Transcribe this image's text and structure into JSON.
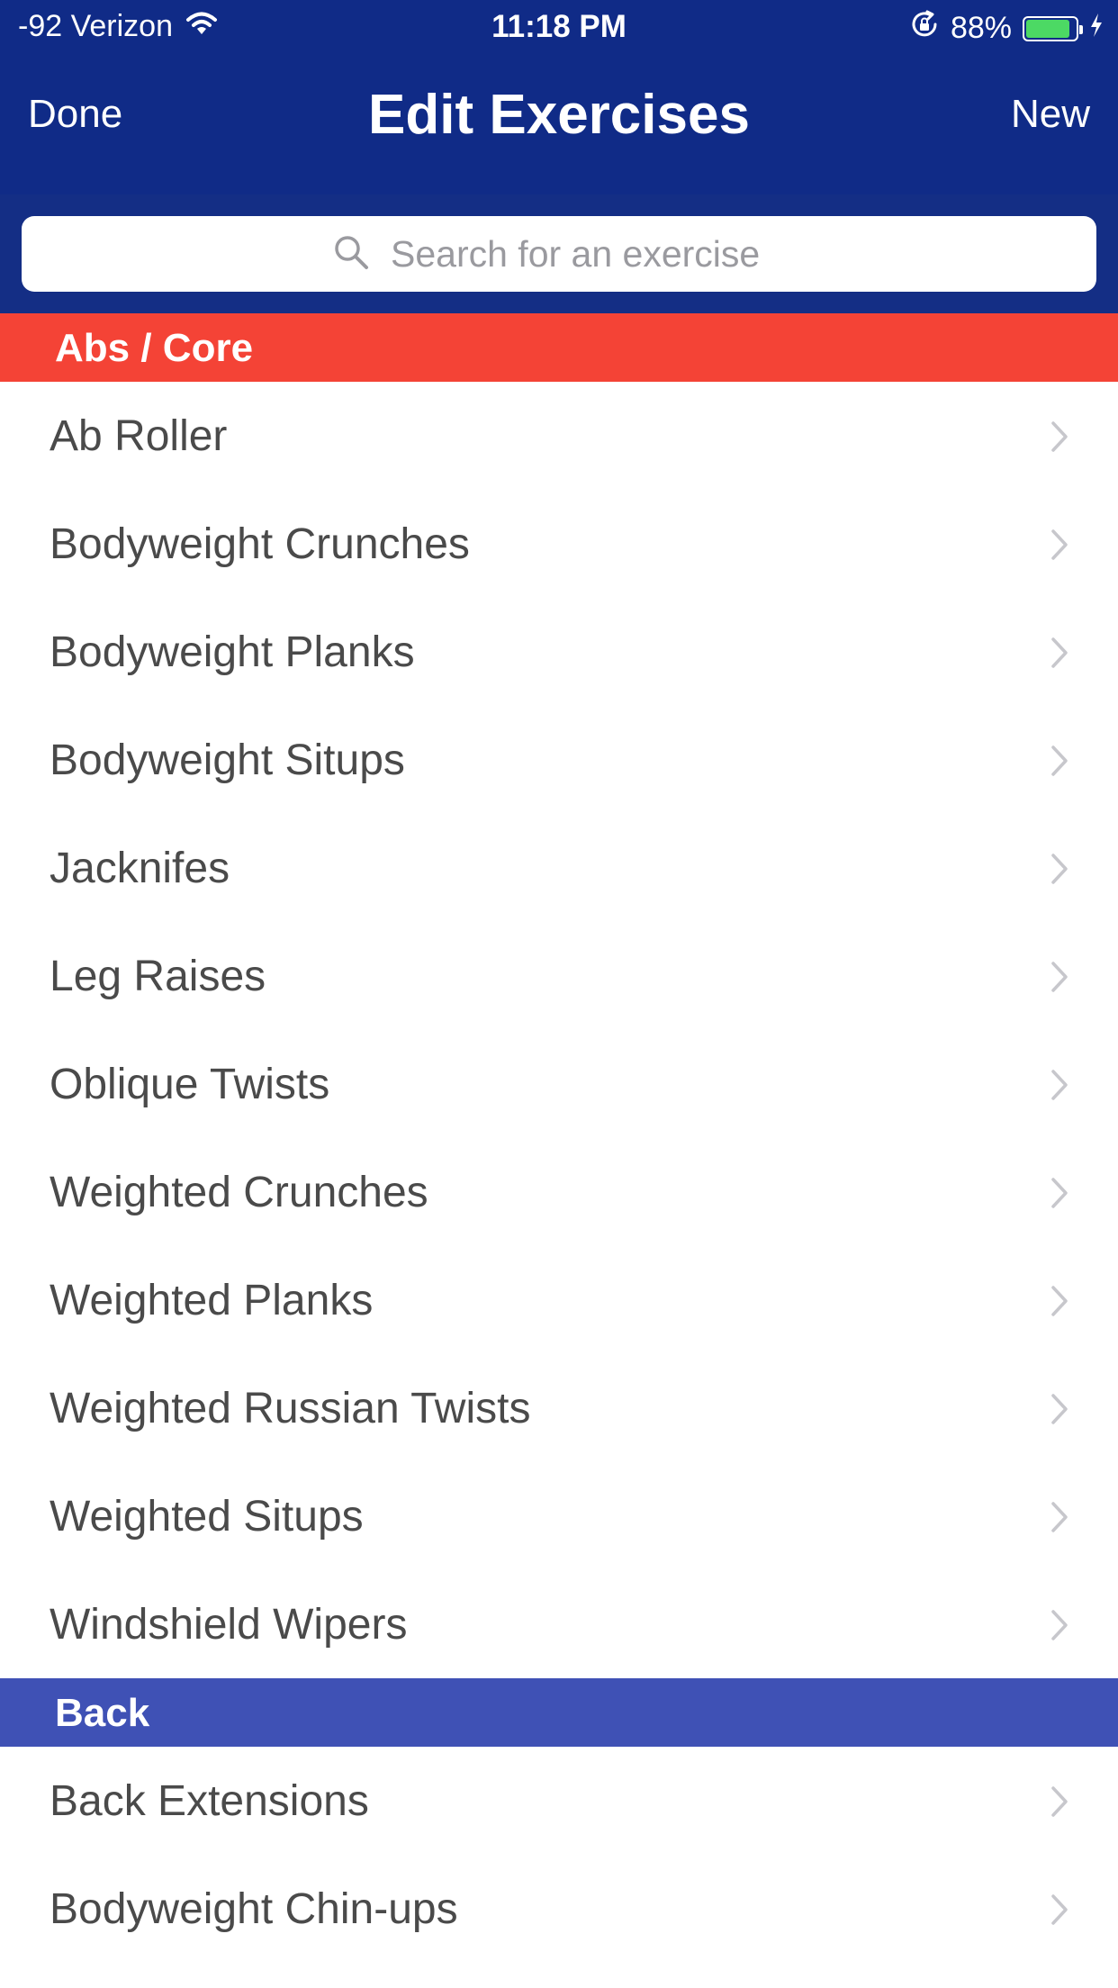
{
  "status_bar": {
    "carrier": "-92 Verizon",
    "time": "11:18 PM",
    "battery_percent": "88%",
    "battery_level": 0.88,
    "battery_color": "#4cd964"
  },
  "nav": {
    "left_button": "Done",
    "title": "Edit Exercises",
    "right_button": "New"
  },
  "search": {
    "placeholder": "Search for an exercise",
    "value": ""
  },
  "sections": [
    {
      "title": "Abs / Core",
      "color": "#f44336",
      "items": [
        "Ab Roller",
        "Bodyweight Crunches",
        "Bodyweight Planks",
        "Bodyweight Situps",
        "Jacknifes",
        "Leg Raises",
        "Oblique Twists",
        "Weighted Crunches",
        "Weighted Planks",
        "Weighted Russian Twists",
        "Weighted Situps",
        "Windshield Wipers"
      ]
    },
    {
      "title": "Back",
      "color": "#3f51b5",
      "items": [
        "Back Extensions",
        "Bodyweight Chin-ups"
      ]
    }
  ],
  "colors": {
    "nav_background": "#102b87",
    "chevron": "#c7c7cc"
  },
  "icons": {
    "wifi": "wifi-icon",
    "rotation_lock": "rotation-lock-icon",
    "battery": "battery-icon",
    "charging": "charging-bolt-icon",
    "search": "search-icon",
    "disclosure": "chevron-right-icon"
  }
}
